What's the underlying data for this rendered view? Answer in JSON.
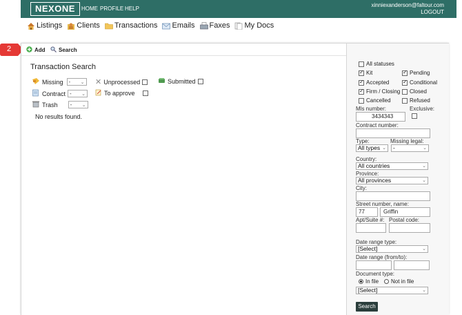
{
  "topbar": {
    "logo": "NEXONE",
    "nav": [
      "HOME",
      "PROFILE",
      "HELP"
    ],
    "email": "xinniexanderson@faltour.com",
    "logout": "LOGOUT"
  },
  "mainnav": {
    "items": [
      {
        "label": "Listings",
        "icon": "house-icon"
      },
      {
        "label": "Clients",
        "icon": "clients-icon"
      },
      {
        "label": "Transactions",
        "icon": "folder-icon"
      },
      {
        "label": "Emails",
        "icon": "envelope-icon"
      },
      {
        "label": "Faxes",
        "icon": "fax-icon"
      },
      {
        "label": "My Docs",
        "icon": "documents-icon"
      }
    ]
  },
  "badge": {
    "number": "2",
    "color": "#e53935"
  },
  "toolbar": {
    "add": "Add",
    "search": "Search"
  },
  "left": {
    "title": "Transaction Search",
    "missing_label": "Missing",
    "missing_value": "-",
    "contract_label": "Contract",
    "contract_value": "-",
    "trash_label": "Trash",
    "trash_value": "-",
    "unprocessed_label": "Unprocessed",
    "toapprove_label": "To approve",
    "submitted_label": "Submitted",
    "no_results": "No results found."
  },
  "right": {
    "all_statuses": "All statuses",
    "kit": "Kit",
    "pending": "Pending",
    "accepted": "Accepted",
    "conditional": "Conditional",
    "firm_closing": "Firm / Closing",
    "closed": "Closed",
    "cancelled": "Cancelled",
    "refused": "Refused",
    "mls_label": "Mls number:",
    "mls_value": "3434343",
    "exclusive_label": "Exclusive:",
    "contract_number_label": "Contract number:",
    "type_label": "Type:",
    "type_value": "All types",
    "missing_legal_label": "Missing legal:",
    "missing_legal_value": "-",
    "country_label": "Country:",
    "country_value": "All countries",
    "province_label": "Province:",
    "province_value": "All provinces",
    "city_label": "City:",
    "street_label": "Street number, name:",
    "street_number": "77",
    "street_name": "Griffin",
    "apt_label": "Apt/Suite #:",
    "postal_label": "Postal code:",
    "date_range_type_label": "Date range type:",
    "date_range_type_value": "[Select]",
    "date_range_label": "Date range (from/to):",
    "doc_type_label": "Document type:",
    "in_file": "In file",
    "not_in_file": "Not in file",
    "doc_type_value": "[Select]",
    "search_button": "Search"
  },
  "colors": {
    "topbar": "#2e6e66",
    "search_button": "#2b3e3c",
    "badge": "#e53935"
  }
}
